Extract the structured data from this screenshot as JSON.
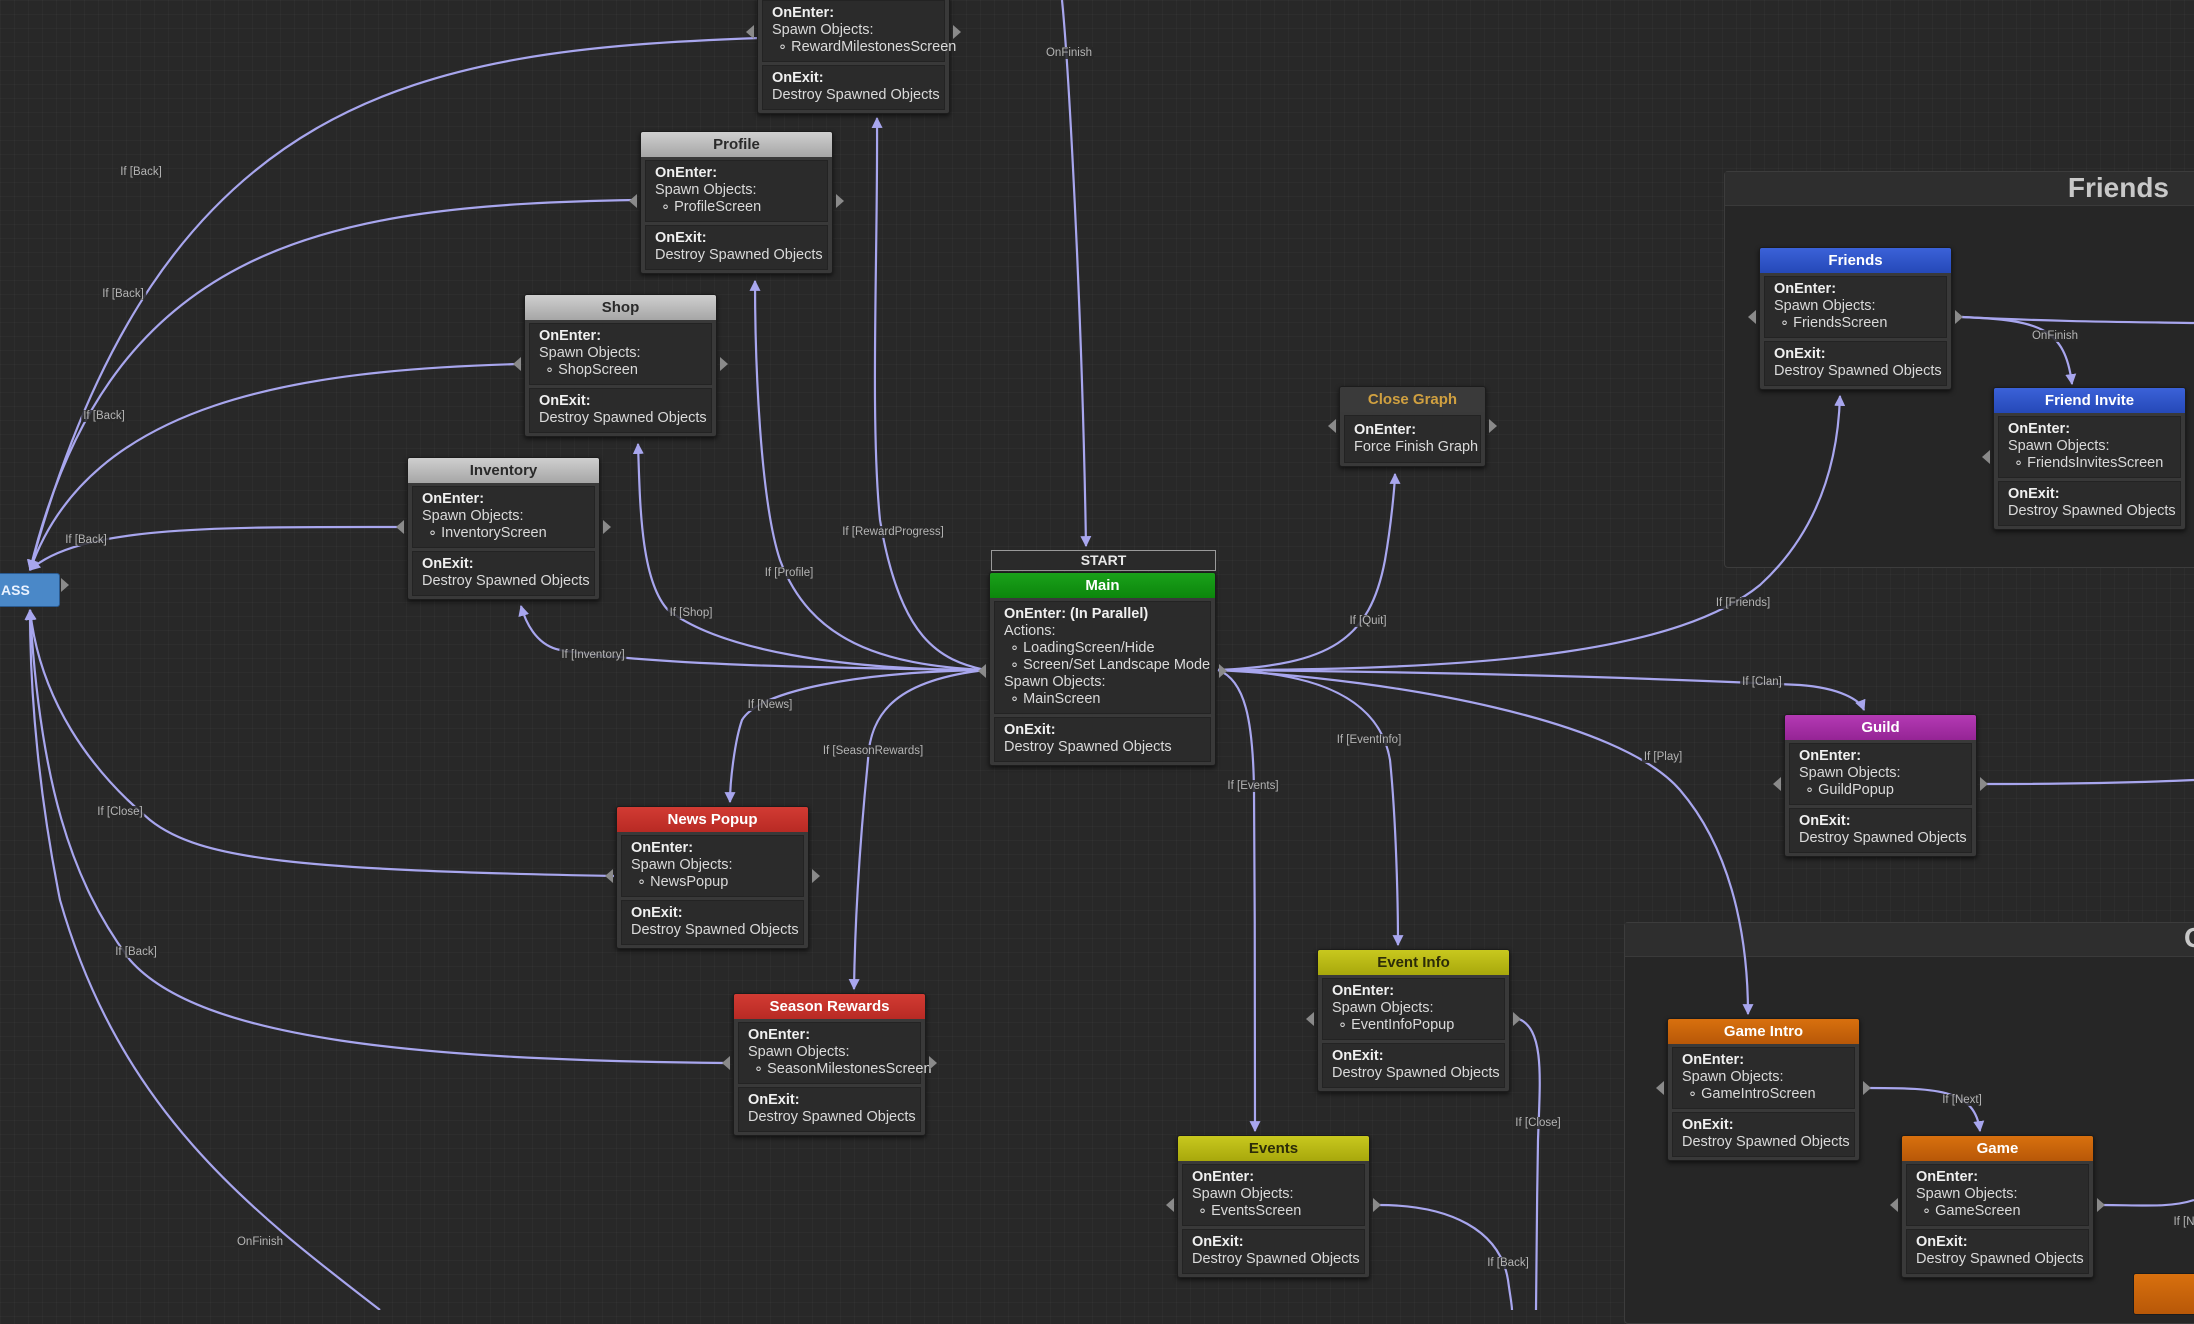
{
  "groups": [
    {
      "title": "Friends"
    },
    {
      "title": "G"
    }
  ],
  "start": {
    "label": "START"
  },
  "pass_node": {
    "label": "ASS"
  },
  "nodes": {
    "reward_milestones": {
      "title": "",
      "onenter_label": "OnEnter:",
      "lines": [
        "Spawn Objects:",
        "∘ RewardMilestonesScreen"
      ],
      "onexit_label": "OnExit:",
      "exit_line": "Destroy Spawned Objects"
    },
    "profile": {
      "title": "Profile",
      "onenter_label": "OnEnter:",
      "lines": [
        "Spawn Objects:",
        "∘ ProfileScreen"
      ],
      "onexit_label": "OnExit:",
      "exit_line": "Destroy Spawned Objects"
    },
    "shop": {
      "title": "Shop",
      "onenter_label": "OnEnter:",
      "lines": [
        "Spawn Objects:",
        "∘ ShopScreen"
      ],
      "onexit_label": "OnExit:",
      "exit_line": "Destroy Spawned Objects"
    },
    "inventory": {
      "title": "Inventory",
      "onenter_label": "OnEnter:",
      "lines": [
        "Spawn Objects:",
        "∘ InventoryScreen"
      ],
      "onexit_label": "OnExit:",
      "exit_line": "Destroy Spawned Objects"
    },
    "main": {
      "title": "Main",
      "onenter_label": "OnEnter: (In Parallel)",
      "lines": [
        "Actions:",
        "∘ LoadingScreen/Hide",
        "∘ Screen/Set Landscape Mode",
        "Spawn Objects:",
        "∘ MainScreen"
      ],
      "onexit_label": "OnExit:",
      "exit_line": "Destroy Spawned Objects"
    },
    "close_graph": {
      "title": "Close Graph",
      "onenter_label": "OnEnter:",
      "lines": [
        "Force Finish Graph"
      ]
    },
    "news_popup": {
      "title": "News Popup",
      "onenter_label": "OnEnter:",
      "lines": [
        "Spawn Objects:",
        "∘ NewsPopup"
      ],
      "onexit_label": "OnExit:",
      "exit_line": "Destroy Spawned Objects"
    },
    "season_rewards": {
      "title": "Season Rewards",
      "onenter_label": "OnEnter:",
      "lines": [
        "Spawn Objects:",
        "∘ SeasonMilestonesScreen"
      ],
      "onexit_label": "OnExit:",
      "exit_line": "Destroy Spawned Objects"
    },
    "event_info": {
      "title": "Event Info",
      "onenter_label": "OnEnter:",
      "lines": [
        "Spawn Objects:",
        "∘ EventInfoPopup"
      ],
      "onexit_label": "OnExit:",
      "exit_line": "Destroy Spawned Objects"
    },
    "events": {
      "title": "Events",
      "onenter_label": "OnEnter:",
      "lines": [
        "Spawn Objects:",
        "∘ EventsScreen"
      ],
      "onexit_label": "OnExit:",
      "exit_line": "Destroy Spawned Objects"
    },
    "friends": {
      "title": "Friends",
      "onenter_label": "OnEnter:",
      "lines": [
        "Spawn Objects:",
        "∘ FriendsScreen"
      ],
      "onexit_label": "OnExit:",
      "exit_line": "Destroy Spawned Objects"
    },
    "friend_invite": {
      "title": "Friend Invite",
      "onenter_label": "OnEnter:",
      "lines": [
        "Spawn Objects:",
        "∘ FriendsInvitesScreen"
      ],
      "onexit_label": "OnExit:",
      "exit_line": "Destroy Spawned Objects"
    },
    "guild": {
      "title": "Guild",
      "onenter_label": "OnEnter:",
      "lines": [
        "Spawn Objects:",
        "∘ GuildPopup"
      ],
      "onexit_label": "OnExit:",
      "exit_line": "Destroy Spawned Objects"
    },
    "game_intro": {
      "title": "Game Intro",
      "onenter_label": "OnEnter:",
      "lines": [
        "Spawn Objects:",
        "∘ GameIntroScreen"
      ],
      "onexit_label": "OnExit:",
      "exit_line": "Destroy Spawned Objects"
    },
    "game": {
      "title": "Game",
      "onenter_label": "OnEnter:",
      "lines": [
        "Spawn Objects:",
        "∘ GameScreen"
      ],
      "onexit_label": "OnExit:",
      "exit_line": "Destroy Spawned Objects"
    }
  },
  "edge_labels": {
    "on_finish_top": "OnFinish",
    "back_1": "If [Back]",
    "back_2": "If [Back]",
    "back_3": "If [Back]",
    "back_4": "If [Back]",
    "reward_progress": "If [RewardProgress]",
    "profile": "If [Profile]",
    "shop": "If [Shop]",
    "inventory": "If [Inventory]",
    "news": "If [News]",
    "season_rewards": "If [SeasonRewards]",
    "close": "If [Close]",
    "back_5": "If [Back]",
    "on_finish_bottom": "OnFinish",
    "quit": "If [Quit]",
    "friends": "If [Friends]",
    "on_finish_friends": "OnFinish",
    "clan": "If [Clan]",
    "event_info": "If [EventInfo]",
    "events": "If [Events]",
    "play": "If [Play]",
    "next": "If [Next]",
    "close_2": "If [Close]",
    "back_6": "If [Back]",
    "partial_n": "If [N"
  },
  "colors": {
    "edge": "#a8a6ee",
    "gray_header": "#c0c0c0",
    "main_header": "#14961a",
    "red_header": "#c8322c",
    "yellow_header": "#b8b814",
    "blue_header": "#2f55cc",
    "purple_header": "#a82ea8",
    "orange_header": "#cc640c"
  }
}
